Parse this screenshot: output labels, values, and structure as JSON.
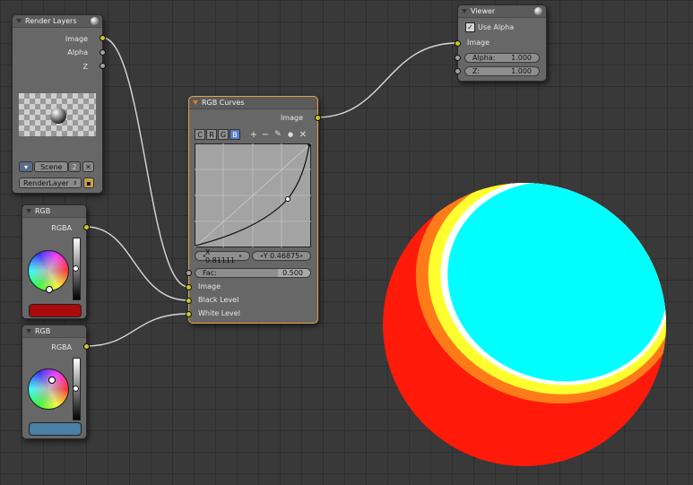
{
  "render_layers": {
    "title": "Render Layers",
    "outputs": [
      "Image",
      "Alpha",
      "Z"
    ],
    "scene": "Scene",
    "scene_users": "2",
    "layer": "RenderLayer"
  },
  "rgb_node_1": {
    "title": "RGB",
    "output": "RGBA",
    "color": "#aa0a0a"
  },
  "rgb_node_2": {
    "title": "RGB",
    "output": "RGBA",
    "color": "#4a7fa6"
  },
  "curves": {
    "title": "RGB Curves",
    "output": "Image",
    "tabs": [
      "C",
      "R",
      "G",
      "B"
    ],
    "selected_tab": "B",
    "tools": [
      "+",
      "−",
      "✎",
      "●",
      "✕"
    ],
    "x_label": "X 0.81111",
    "y_label": "Y 0.46875",
    "fac_label": "Fac:",
    "fac_value": "0.500",
    "inputs": [
      "Image",
      "Black Level",
      "White Level"
    ]
  },
  "viewer": {
    "title": "Viewer",
    "use_alpha_label": "Use Alpha",
    "input": "Image",
    "alpha_label": "Alpha:",
    "alpha_value": "1.000",
    "z_label": "Z:",
    "z_value": "1.000"
  },
  "colors": {
    "socket_yellow": "#c7c729",
    "socket_gray": "#a1a1a1",
    "active_outline": "#e8a23c",
    "link": "#d8d8d8"
  }
}
